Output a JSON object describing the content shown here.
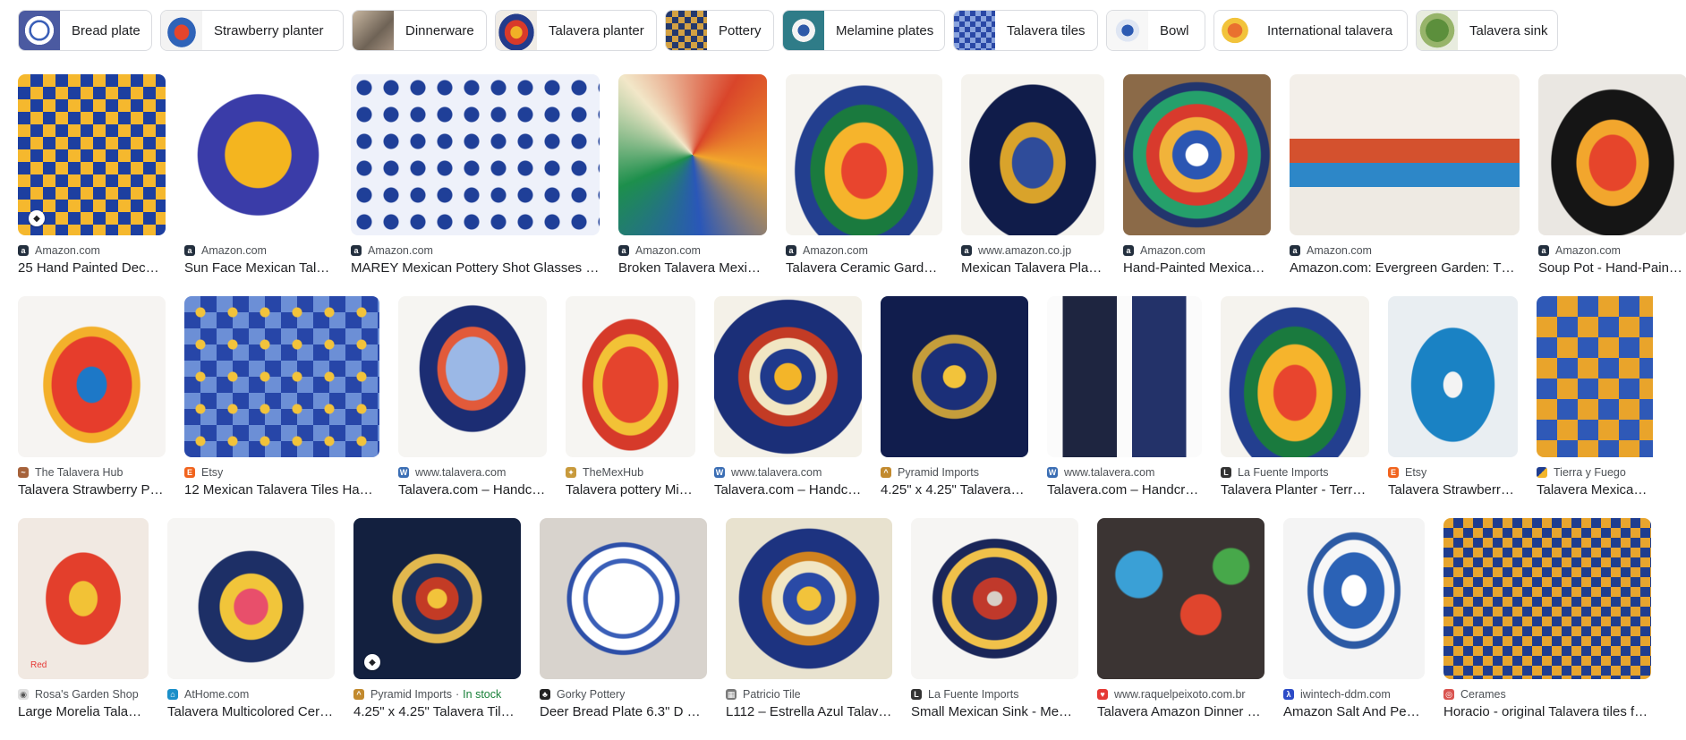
{
  "chips": [
    {
      "label": "Bread plate",
      "thumb": "bread-plate-thumb"
    },
    {
      "label": "Strawberry planter",
      "thumb": "strawberry-planter-thumb"
    },
    {
      "label": "Dinnerware",
      "thumb": "dinnerware-thumb"
    },
    {
      "label": "Talavera planter",
      "thumb": "talavera-planter-thumb"
    },
    {
      "label": "Pottery",
      "thumb": "pottery-thumb"
    },
    {
      "label": "Melamine plates",
      "thumb": "melamine-plates-thumb"
    },
    {
      "label": "Talavera tiles",
      "thumb": "talavera-tiles-thumb"
    },
    {
      "label": "Bowl",
      "thumb": "bowl-thumb"
    },
    {
      "label": "International talavera",
      "thumb": "international-talavera-thumb"
    },
    {
      "label": "Talavera sink",
      "thumb": "talavera-sink-thumb"
    }
  ],
  "rows": [
    [
      {
        "source": "Amazon.com",
        "title": "25 Hand Painted Dec…",
        "favicon": "amazon-icon"
      },
      {
        "source": "Amazon.com",
        "title": "Sun Face Mexican Tal…",
        "favicon": "amazon-icon"
      },
      {
        "source": "Amazon.com",
        "title": "MAREY Mexican Pottery Shot Glasses …",
        "favicon": "amazon-icon"
      },
      {
        "source": "Amazon.com",
        "title": "Broken Talavera Mexi…",
        "favicon": "amazon-icon"
      },
      {
        "source": "Amazon.com",
        "title": "Talavera Ceramic Gard…",
        "favicon": "amazon-icon"
      },
      {
        "source": "www.amazon.co.jp",
        "title": "Mexican Talavera Pla…",
        "favicon": "amazon-icon"
      },
      {
        "source": "Amazon.com",
        "title": "Hand-Painted Mexica…",
        "favicon": "amazon-icon"
      },
      {
        "source": "Amazon.com",
        "title": "Amazon.com: Evergreen Garden: T…",
        "favicon": "amazon-icon"
      },
      {
        "source": "Amazon.com",
        "title": "Soup Pot - Hand-Pain…",
        "favicon": "amazon-icon"
      }
    ],
    [
      {
        "source": "The Talavera Hub",
        "title": "Talavera Strawberry P…",
        "favicon": "talavera-hub-icon"
      },
      {
        "source": "Etsy",
        "title": "12 Mexican Talavera Tiles Han…",
        "favicon": "etsy-icon"
      },
      {
        "source": "www.talavera.com",
        "title": "Talavera.com – Handc…",
        "favicon": "wordpress-icon"
      },
      {
        "source": "TheMexHub",
        "title": "Talavera pottery Mi…",
        "favicon": "mexhub-icon"
      },
      {
        "source": "www.talavera.com",
        "title": "Talavera.com – Handc…",
        "favicon": "wordpress-icon"
      },
      {
        "source": "Pyramid Imports",
        "title": "4.25\" x 4.25\" Talavera…",
        "favicon": "pyramid-icon"
      },
      {
        "source": "www.talavera.com",
        "title": "Talavera.com – Handcr…",
        "favicon": "wordpress-icon"
      },
      {
        "source": "La Fuente Imports",
        "title": "Talavera Planter - Terr…",
        "favicon": "lafuente-icon"
      },
      {
        "source": "Etsy",
        "title": "Talavera Strawberr…",
        "favicon": "etsy-icon"
      },
      {
        "source": "Tierra y Fuego",
        "title": "Talavera Mexican Tile …",
        "favicon": "tierra-icon"
      }
    ],
    [
      {
        "source": "Rosa's Garden Shop",
        "title": "Large Morelia Tala…",
        "favicon": "rosa-icon",
        "note": "Red"
      },
      {
        "source": "AtHome.com",
        "title": "Talavera Multicolored Cer…",
        "favicon": "athome-icon"
      },
      {
        "source": "Pyramid Imports",
        "stock": "In stock",
        "title": "4.25\" x 4.25\" Talavera Til…",
        "favicon": "pyramid-icon"
      },
      {
        "source": "Gorky Pottery",
        "title": "Deer Bread Plate 6.3\" D …",
        "favicon": "gorky-icon"
      },
      {
        "source": "Patricio Tile",
        "title": "L112 – Estrella Azul Talav…",
        "favicon": "patricio-icon"
      },
      {
        "source": "La Fuente Imports",
        "title": "Small Mexican Sink - Me…",
        "favicon": "lafuente-icon"
      },
      {
        "source": "www.raquelpeixoto.com.br",
        "title": "Talavera Amazon Dinner …",
        "favicon": "raquel-icon"
      },
      {
        "source": "iwintech-ddm.com",
        "title": "Amazon Salt And Pe…",
        "favicon": "iwintech-icon"
      },
      {
        "source": "Cerames",
        "title": "Horacio - original Talavera tiles from …",
        "favicon": "cerames-icon"
      }
    ]
  ]
}
